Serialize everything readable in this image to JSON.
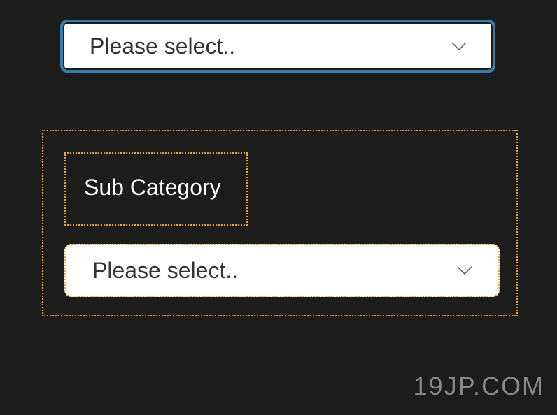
{
  "primary_select": {
    "placeholder": "Please select.."
  },
  "sub_panel": {
    "label": "Sub Category",
    "select": {
      "placeholder": "Please select.."
    }
  },
  "watermark": "19JP.COM"
}
